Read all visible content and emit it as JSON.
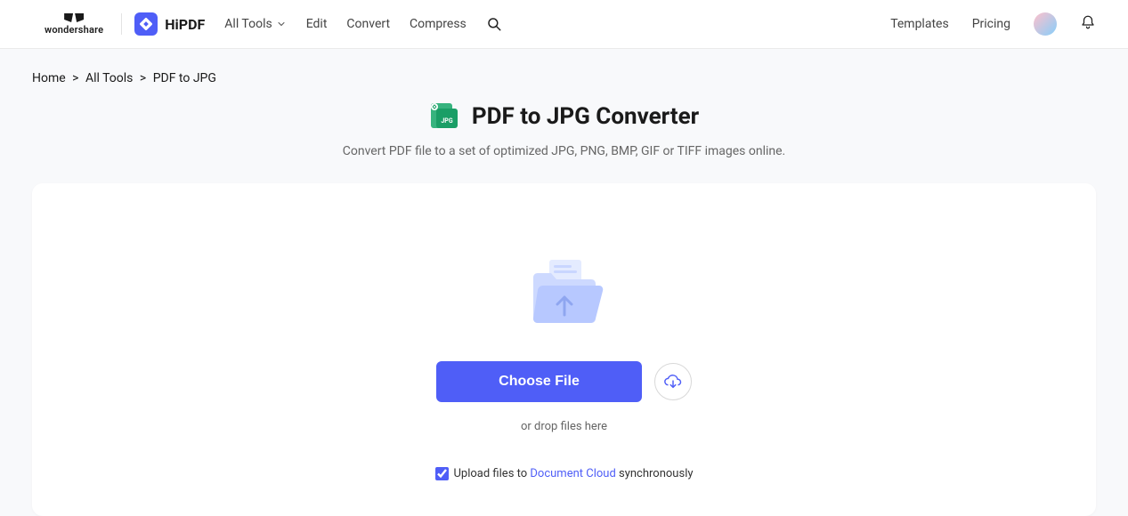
{
  "header": {
    "brand_wondershare": "wondershare",
    "brand_hipdf": "HiPDF",
    "nav": {
      "all_tools": "All Tools",
      "edit": "Edit",
      "convert": "Convert",
      "compress": "Compress"
    },
    "right": {
      "templates": "Templates",
      "pricing": "Pricing"
    }
  },
  "breadcrumb": {
    "home": "Home",
    "all_tools": "All Tools",
    "current": "PDF to JPG"
  },
  "page": {
    "title": "PDF to JPG Converter",
    "subtitle": "Convert PDF file to a set of optimized JPG, PNG, BMP, GIF or TIFF images online."
  },
  "upload": {
    "choose_file": "Choose File",
    "drop_hint": "or drop files here",
    "sync_prefix": "Upload files to ",
    "sync_link": "Document Cloud",
    "sync_suffix": " synchronously"
  }
}
